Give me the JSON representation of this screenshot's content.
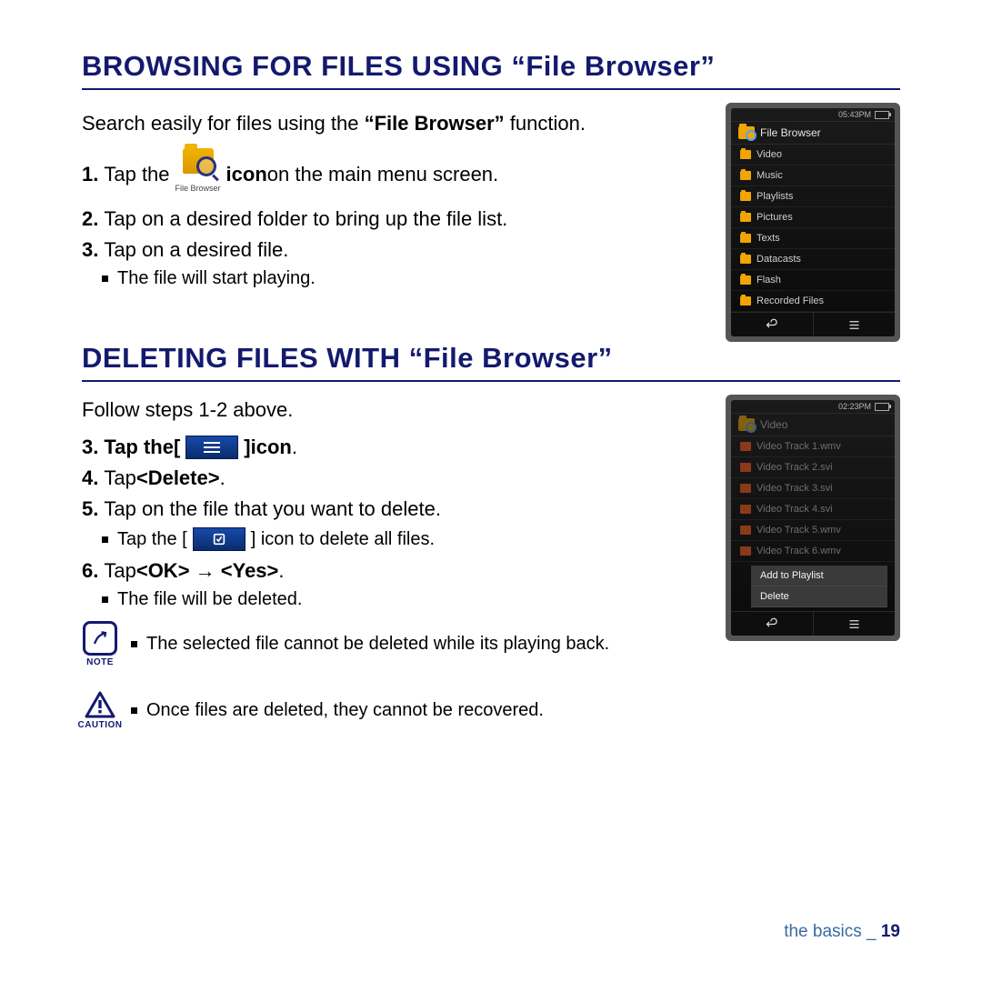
{
  "section1": {
    "title": "BROWSING FOR FILES USING “File Browser”",
    "intro_pre": "Search easily for files using the ",
    "intro_bold": "“File Browser”",
    "intro_post": " function.",
    "steps": {
      "s1_num": "1.",
      "s1_pre": " Tap the ",
      "s1_icon_caption": "File Browser",
      "s1_bold": "icon",
      "s1_post": " on the main menu screen.",
      "s2_num": "2.",
      "s2_text": " Tap on a desired folder to bring up the file list.",
      "s3_num": "3.",
      "s3_text": " Tap on a desired file.",
      "s3_sub": "The file will start playing."
    }
  },
  "section2": {
    "title": "DELETING FILES WITH “File Browser”",
    "intro": "Follow steps 1-2 above.",
    "steps": {
      "s3_num": "3.",
      "s3_pre": " Tap the ",
      "s3_br_open": "[",
      "s3_br_close": "]",
      "s3_bold": " icon",
      "s3_post": ".",
      "s4_num": "4.",
      "s4_pre": " Tap ",
      "s4_bold": "<Delete>",
      "s4_post": ".",
      "s5_num": "5.",
      "s5_text": " Tap on the file that you want to delete.",
      "s5_sub_pre": "Tap the [",
      "s5_sub_post": "] icon to delete all files.",
      "s6_num": "6.",
      "s6_pre": " Tap ",
      "s6_bold": "<OK> → <Yes>",
      "s6_post": ".",
      "s6_sub": "The file will be deleted."
    },
    "note": {
      "label": "NOTE",
      "text": "The selected file cannot be deleted while its playing back."
    },
    "caution": {
      "label": "CAUTION",
      "text": "Once files are deleted, they cannot be recovered."
    }
  },
  "device1": {
    "time": "05:43PM",
    "title": "File Browser",
    "rows": [
      "Video",
      "Music",
      "Playlists",
      "Pictures",
      "Texts",
      "Datacasts",
      "Flash",
      "Recorded Files"
    ]
  },
  "device2": {
    "time": "02:23PM",
    "title": "Video",
    "rows": [
      "Video Track 1.wmv",
      "Video Track 2.svi",
      "Video Track 3.svi",
      "Video Track 4.svi",
      "Video Track 5.wmv",
      "Video Track 6.wmv"
    ],
    "popup": [
      "Add to Playlist",
      "Delete"
    ]
  },
  "footer": {
    "section": "the basics _ ",
    "page": "19"
  }
}
